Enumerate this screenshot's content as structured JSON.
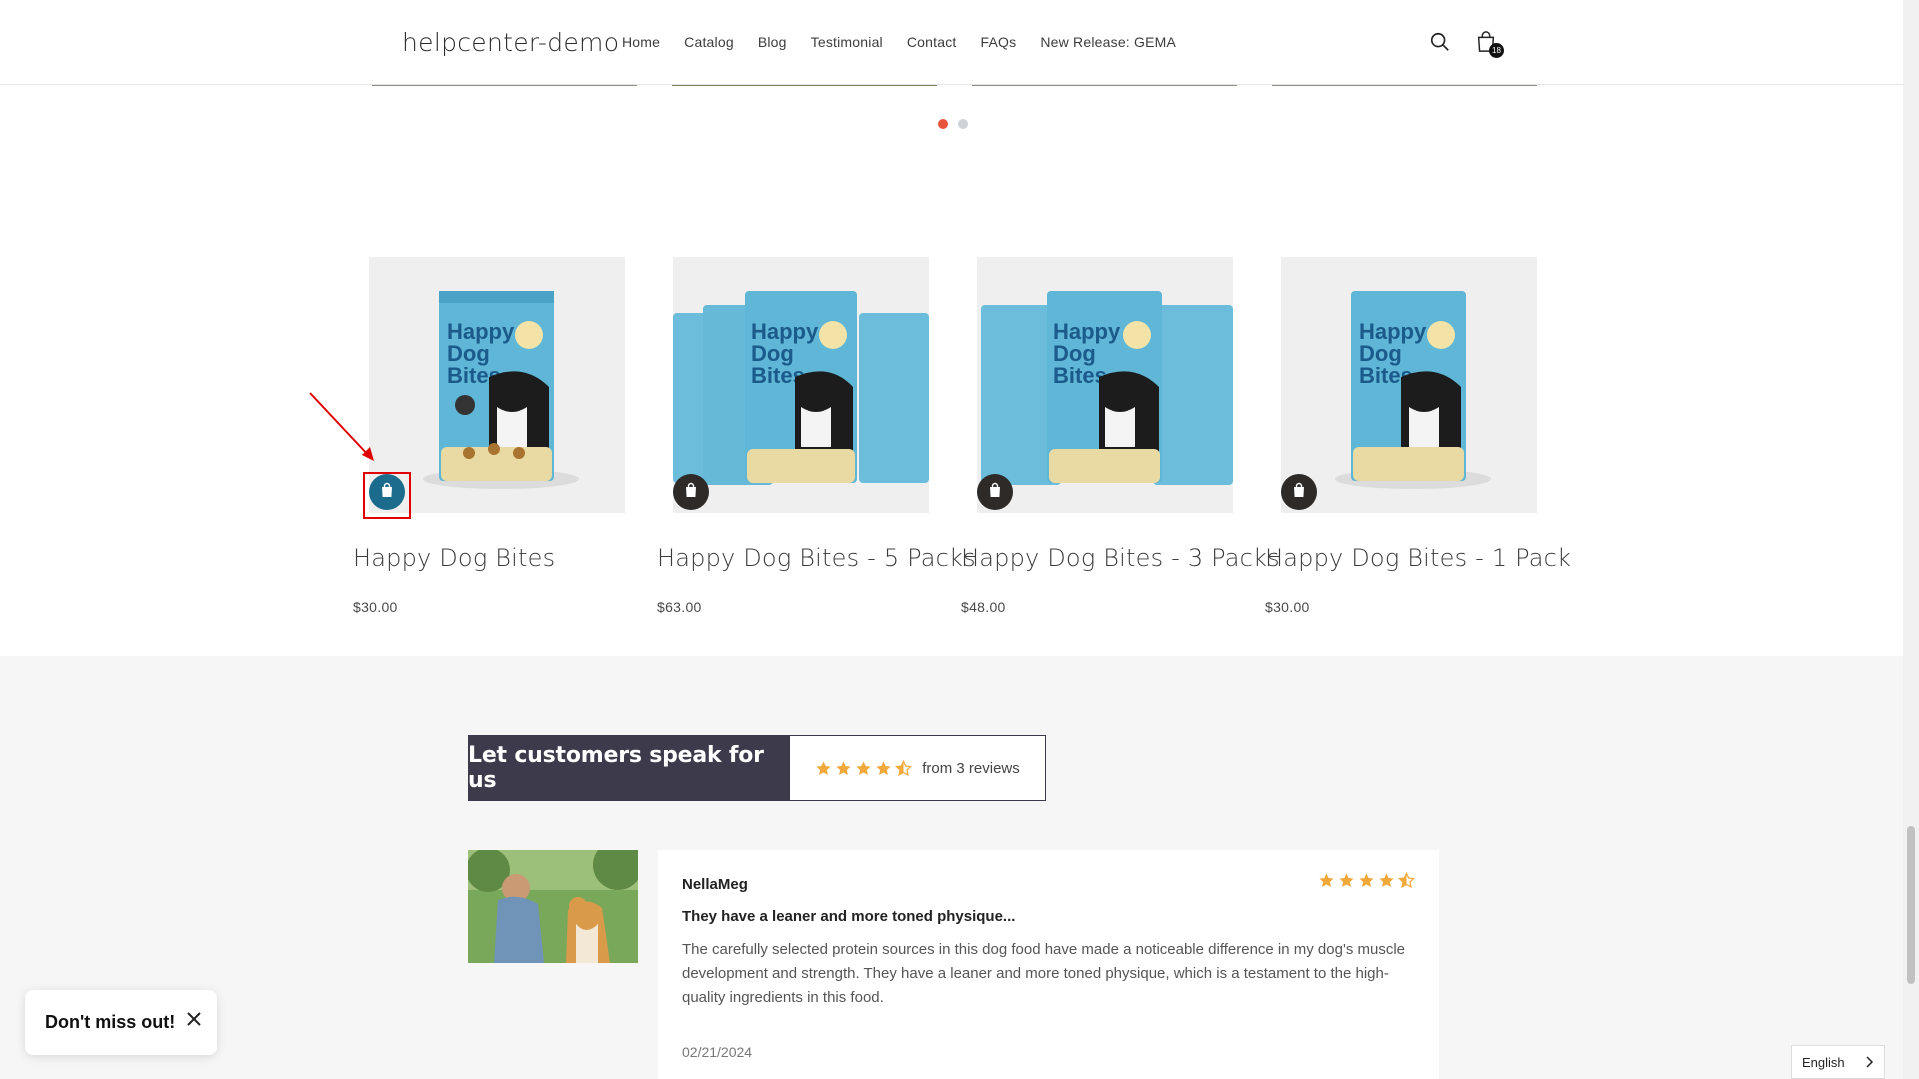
{
  "header": {
    "brand": "helpcenter-demo",
    "nav": [
      "Home",
      "Catalog",
      "Blog",
      "Testimonial",
      "Contact",
      "FAQs",
      "New Release: GEMA"
    ],
    "cart_count": "18"
  },
  "products": [
    {
      "title": "Happy Dog Bites",
      "price": "$30.00"
    },
    {
      "title": "Happy Dog Bites - 5 Packs",
      "price": "$63.00"
    },
    {
      "title": "Happy Dog Bites - 3 Packs",
      "price": "$48.00"
    },
    {
      "title": "Happy Dog Bites - 1 Pack",
      "price": "$30.00"
    }
  ],
  "package_text": {
    "line1": "Happy",
    "line2": "Dog",
    "line3": "Bites"
  },
  "reviews": {
    "heading": "Let customers speak for us",
    "summary": "from 3 reviews",
    "rating": 4.5,
    "item": {
      "author": "NellaMeg",
      "title": "They have a leaner and more toned physique...",
      "body": "The carefully selected protein sources in this dog food have made a noticeable difference in my dog's muscle development and strength. They have a leaner and more toned physique, which is a testament to the high-quality ingredients in this food.",
      "date": "02/21/2024",
      "rating": 4.5
    }
  },
  "popup": {
    "text": "Don't miss out!"
  },
  "language": {
    "label": "English"
  },
  "colors": {
    "accent_dot": "#e9543d",
    "highlight_button": "#1a6b8c",
    "star": "#f2a93b",
    "dark_panel": "#3d3a4b"
  }
}
